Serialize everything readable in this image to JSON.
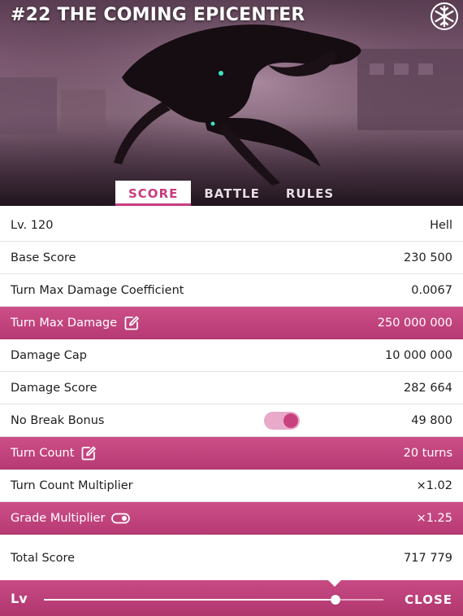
{
  "header": {
    "title": "#22 THE COMING EPICENTER",
    "snowflake_icon": "snowflake-icon"
  },
  "tabs": [
    {
      "label": "SCORE",
      "active": true
    },
    {
      "label": "BATTLE",
      "active": false
    },
    {
      "label": "RULES",
      "active": false
    }
  ],
  "rows": {
    "level": {
      "label": "Lv. 120",
      "value": "Hell"
    },
    "base_score": {
      "label": "Base Score",
      "value": "230 500"
    },
    "coefficient": {
      "label": "Turn Max Damage Coefficient",
      "value": "0.0067"
    },
    "max_damage": {
      "label": "Turn Max Damage",
      "value": "250 000 000",
      "icon": "edit-icon"
    },
    "damage_cap": {
      "label": "Damage Cap",
      "value": "10 000 000"
    },
    "damage_score": {
      "label": "Damage Score",
      "value": "282 664"
    },
    "no_break": {
      "label": "No Break Bonus",
      "value": "49 800",
      "toggle_on": true
    },
    "turn_count": {
      "label": "Turn Count",
      "value": "20 turns",
      "icon": "edit-icon"
    },
    "turn_multiplier": {
      "label": "Turn Count Multiplier",
      "value": "×1.02"
    },
    "grade_multiplier": {
      "label": "Grade Multiplier",
      "value": "×1.25",
      "icon": "toggle-icon"
    },
    "total": {
      "label": "Total Score",
      "value": "717 779"
    }
  },
  "footer": {
    "lv_label": "Lv",
    "slider_value_fraction": 0.86,
    "close_label": "CLOSE"
  },
  "colors": {
    "accent": "#c83c7e",
    "pink_row": "#bf4179",
    "toggle_track": "#e9a9c8"
  }
}
